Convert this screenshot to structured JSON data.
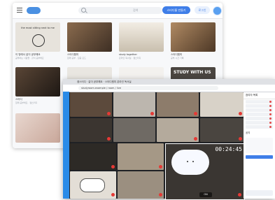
{
  "back_window": {
    "header": {
      "search_placeholder": "검색",
      "primary_button": "스터디룸 만들기",
      "secondary_button": "로그인"
    },
    "cards": [
      {
        "title": "이 방에서 같이 공부해요",
        "meta": "공부하는 사람들 · 같이 공부해요",
        "thumb": "#e7e3dc",
        "tag": "the most sitting next to me"
      },
      {
        "title": "스터디윗미",
        "meta": "함께 공부 · 집중 모드",
        "thumb": "#6b5a45"
      },
      {
        "title": "study together",
        "meta": "온라인 독서실 · 캠스터디",
        "thumb": "#d9d2c2"
      },
      {
        "title": "스터디윗미",
        "meta": "공부 시간 기록",
        "thumb": "#8a6b4e"
      },
      {
        "title": "스터디",
        "meta": "함께 공부해요 · 캠스터디",
        "thumb": "#3a2f26"
      },
      {
        "title": "",
        "meta": "",
        "thumb": "#e9e6e1"
      },
      {
        "title": "",
        "meta": "",
        "thumb": "#f3f1ee"
      },
      {
        "title": "STUDY WITH US",
        "meta": "",
        "thumb": "#4a4540"
      }
    ]
  },
  "front_window": {
    "tab_title": "캠스터디 · 같이 공부해요 · 스터디윗미 온라인 독서실",
    "url": "studyroom.example / room / live",
    "timer": "00:24:45",
    "badge": "ON",
    "chat": {
      "title": "참여자 목록",
      "notice": "공지"
    },
    "tiles": [
      {
        "c": "#5c4a3c"
      },
      {
        "c": "#bcb6ae"
      },
      {
        "c": "#8d7c6b"
      },
      {
        "c": "#d8d2c8"
      },
      {
        "c": "#3b3530"
      },
      {
        "c": "#6f6a64"
      },
      {
        "c": "#b4aa9c"
      },
      {
        "c": "#4a4540"
      },
      {
        "c": "#2d2a26"
      },
      {
        "c": "#a59886"
      },
      {
        "c": "#cfc7bc"
      },
      {
        "c": "#5e5247"
      },
      {
        "c": "#e3ded6"
      },
      {
        "c": "#9b8f80"
      }
    ]
  },
  "colors": {
    "accent": "#3f7ee8",
    "live_red": "#e53935",
    "sidebar_blue": "#2a8be8"
  }
}
